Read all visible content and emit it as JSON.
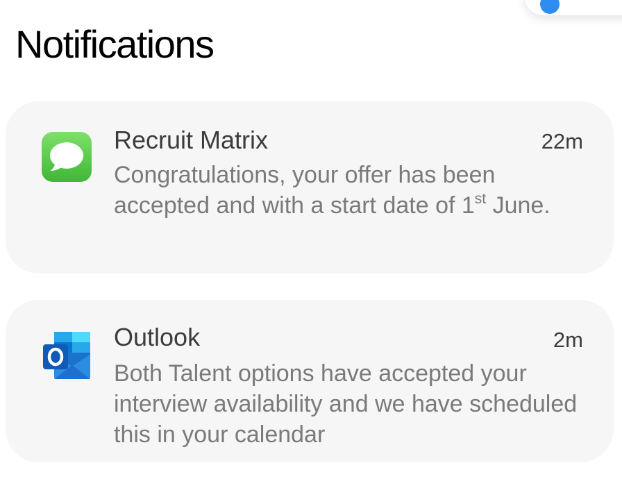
{
  "header": {
    "title": "Notifications"
  },
  "notifications": [
    {
      "app": "Recruit Matrix",
      "icon": "messages-icon",
      "time": "22m",
      "message_before": "Congratulations, your offer has been accepted and with a start date of 1",
      "message_sup": "st",
      "message_after": " June."
    },
    {
      "app": "Outlook",
      "icon": "outlook-icon",
      "time": "2m",
      "message_before": "Both Talent options have accepted your interview availability and we have scheduled this in your calendar",
      "message_sup": "",
      "message_after": ""
    }
  ],
  "colors": {
    "card_background": "#f6f6f6",
    "messages_green": "#5fcc4a",
    "outlook_blue": "#1f6fd0"
  }
}
